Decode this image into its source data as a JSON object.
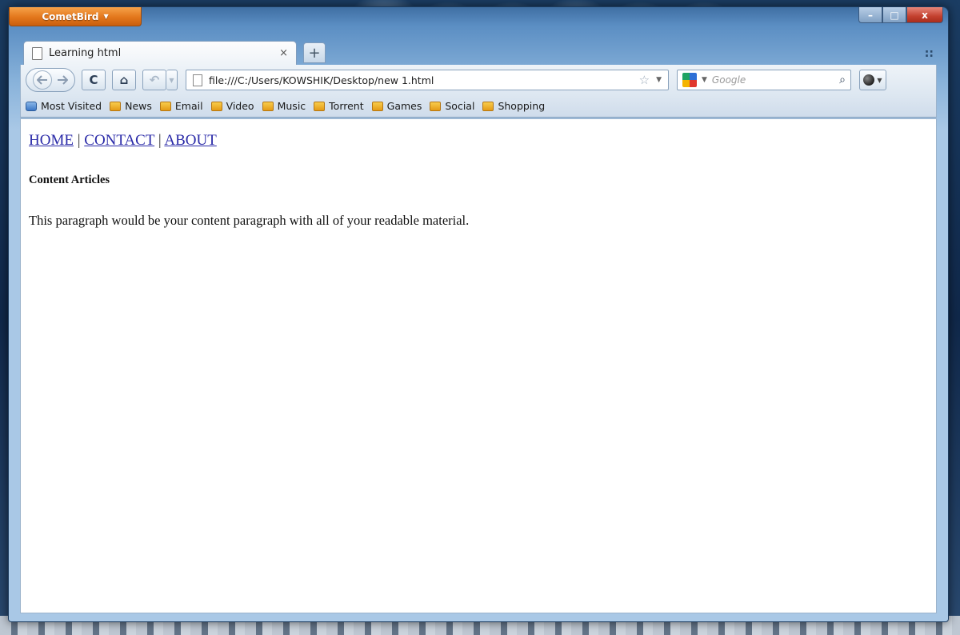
{
  "browser": {
    "app_menu_label": "CometBird",
    "app_menu_arrow": "▼",
    "window_controls": {
      "minimize": "–",
      "maximize": "□",
      "close": "x"
    }
  },
  "tabs": [
    {
      "title": "Learning html",
      "close": "×",
      "active": true
    }
  ],
  "new_tab_label": "+",
  "tab_list_icon": "::",
  "nav": {
    "back_icon": "arrow-left-icon",
    "forward_icon": "arrow-right-icon",
    "reload_glyph": "C",
    "home_glyph": "⌂",
    "history_glyph": "↶",
    "url": "file:///C:/Users/KOWSHIK/Desktop/new 1.html",
    "bookmark_star": "☆",
    "dropdown": "▼"
  },
  "search": {
    "engine": "Google",
    "placeholder": "Google",
    "dropdown": "▼",
    "magnifier": "⌕"
  },
  "bookmarks": [
    {
      "label": "Most Visited",
      "icon": "most-visited-icon"
    },
    {
      "label": "News",
      "icon": "rss-folder-icon"
    },
    {
      "label": "Email",
      "icon": "rss-folder-icon"
    },
    {
      "label": "Video",
      "icon": "rss-folder-icon"
    },
    {
      "label": "Music",
      "icon": "rss-folder-icon"
    },
    {
      "label": "Torrent",
      "icon": "rss-folder-icon"
    },
    {
      "label": "Games",
      "icon": "rss-folder-icon"
    },
    {
      "label": "Social",
      "icon": "rss-folder-icon"
    },
    {
      "label": "Shopping",
      "icon": "rss-folder-icon"
    }
  ],
  "page": {
    "nav_links": [
      "HOME",
      "CONTACT",
      "ABOUT"
    ],
    "separator": "|",
    "heading": "Content Articles",
    "paragraph": "This paragraph would be your content paragraph with all of your readable material."
  },
  "colors": {
    "link": "#2a2aa8",
    "app_button": "#e3761b",
    "close_button": "#c3402e",
    "frame": "#a9c8e6"
  }
}
